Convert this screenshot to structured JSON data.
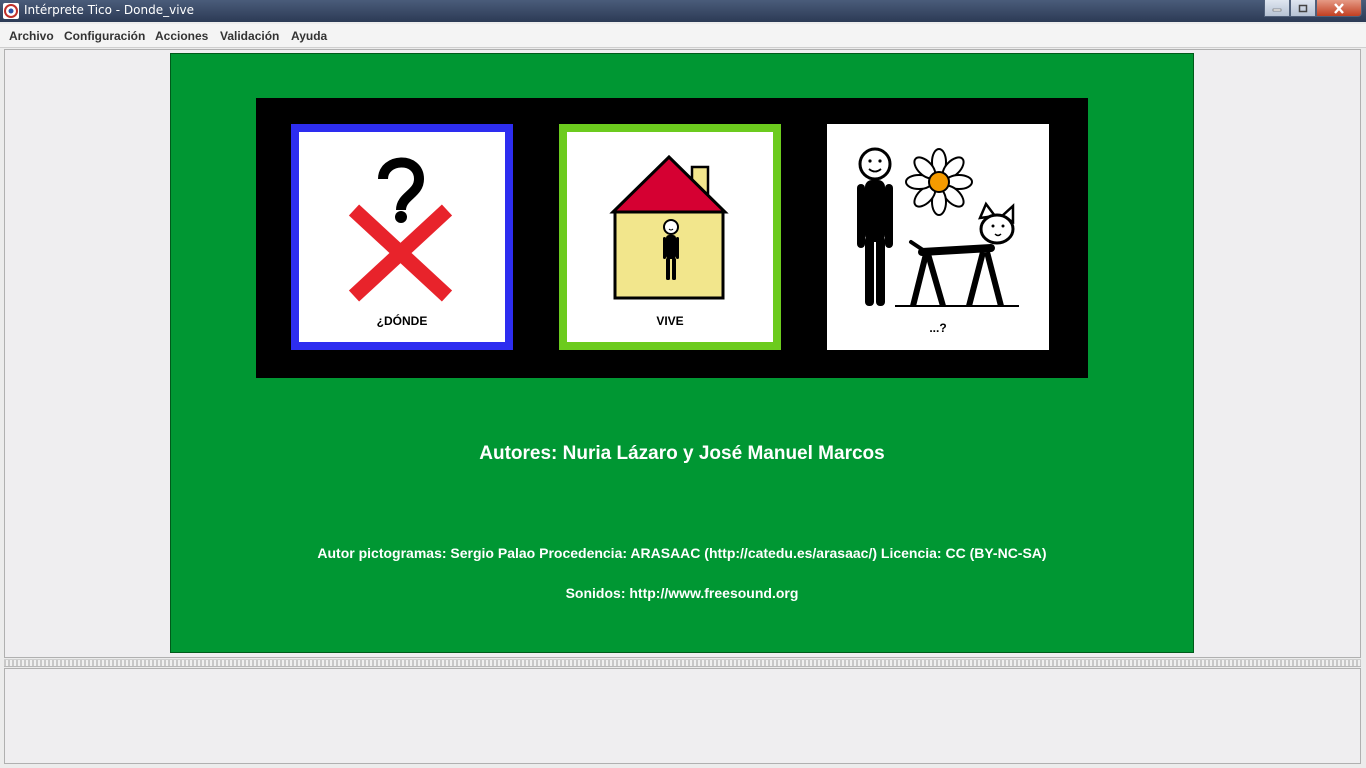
{
  "window": {
    "title": "Intérprete Tico - Donde_vive"
  },
  "menu": [
    "Archivo",
    "Configuración",
    "Acciones",
    "Validación",
    "Ayuda"
  ],
  "cells": [
    {
      "label": "¿DÓNDE",
      "border_color": "#2d2df0",
      "icon": "question-cross-icon"
    },
    {
      "label": "VIVE",
      "border_color": "#6ccb1e",
      "icon": "house-person-icon"
    },
    {
      "label": "...?",
      "border_color": "",
      "icon": "person-flower-cat-icon"
    }
  ],
  "board": {
    "background": "#009733",
    "authors": "Autores: Nuria Lázaro y José Manuel Marcos",
    "credits": "Autor pictogramas: Sergio Palao Procedencia: ARASAAC (http://catedu.es/arasaac/) Licencia: CC (BY-NC-SA)",
    "sounds": "Sonidos: http://www.freesound.org"
  }
}
